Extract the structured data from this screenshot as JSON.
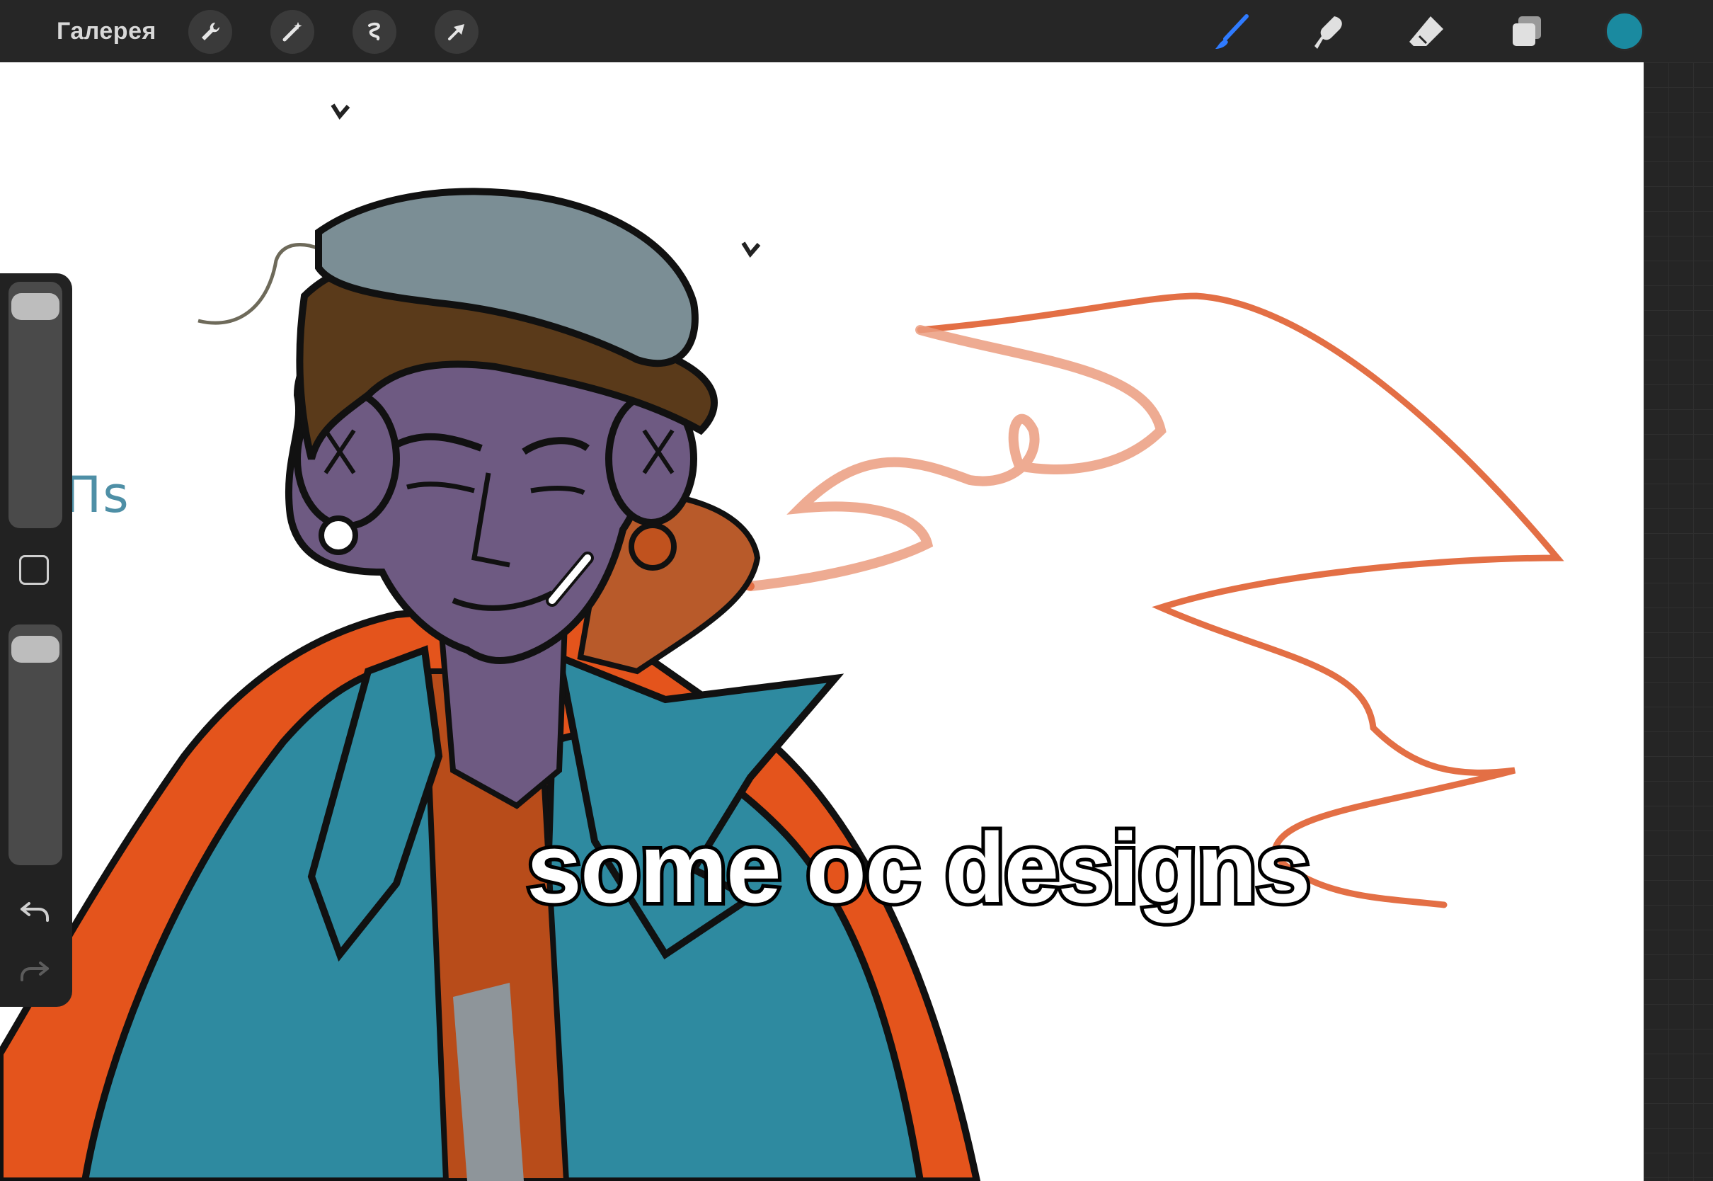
{
  "topbar": {
    "gallery_label": "Галерея",
    "left_tools": [
      "wrench-icon",
      "magic-wand-icon",
      "selection-icon",
      "transform-arrow-icon"
    ],
    "right_tools": [
      "brush-icon",
      "smudge-icon",
      "eraser-icon",
      "layers-icon"
    ],
    "active_tool": "brush-icon",
    "current_color": "#1a8aa0"
  },
  "canvas": {
    "caption": "some oc designs",
    "partial_text": "ɪΠΠs",
    "palette": {
      "skin": "#6e5a82",
      "jacket": "#2e8aa0",
      "outline_orange": "#e4541c",
      "hair": "#5a3a1a",
      "cap": "#7b8e95",
      "smoke": "#e07a50"
    }
  },
  "sidebar": {
    "brush_size_level": 0.95,
    "opacity_level": 0.95,
    "icons": [
      "modify-square-icon",
      "undo-icon",
      "redo-icon"
    ]
  }
}
